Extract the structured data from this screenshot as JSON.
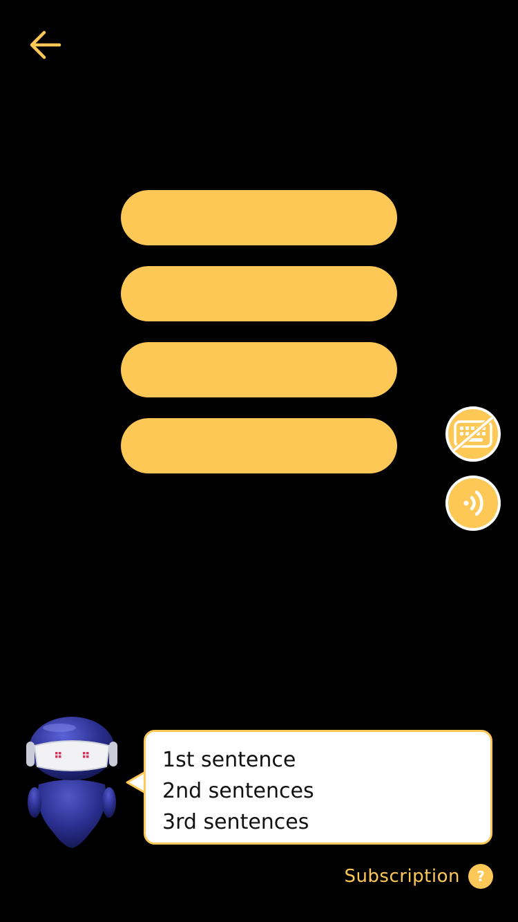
{
  "theme": {
    "accent": "#FEC857",
    "background": "#000000",
    "mascot_body": "#2B2F8F",
    "mascot_eyes": "#D8335A"
  },
  "header": {
    "back_icon": "arrow-left-icon"
  },
  "options": [
    {
      "label": ""
    },
    {
      "label": ""
    },
    {
      "label": ""
    },
    {
      "label": ""
    }
  ],
  "side_controls": {
    "keyboard_icon": "keyboard-off-icon",
    "audio_icon": "sound-wave-icon"
  },
  "speech_bubble": {
    "lines": [
      "1st sentence",
      "2nd sentences",
      "3rd sentences"
    ]
  },
  "footer": {
    "subscription_label": "Subscription",
    "help_symbol": "?"
  }
}
